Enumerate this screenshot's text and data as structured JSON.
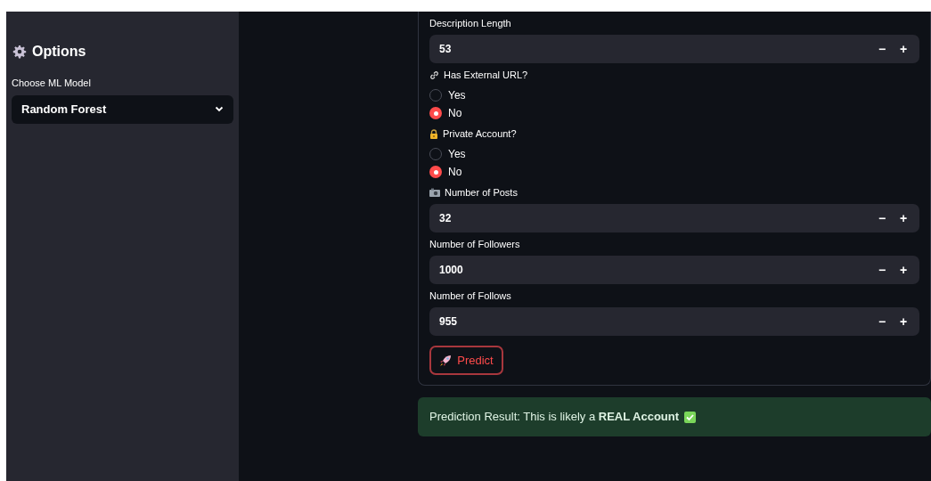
{
  "sidebar": {
    "title": "Options",
    "model_select": {
      "label": "Choose ML Model",
      "value": "Random Forest"
    }
  },
  "form": {
    "fields": [
      {
        "kind": "number",
        "label": "Description Length",
        "value": "53",
        "decrement": "−",
        "increment": "+"
      },
      {
        "kind": "radio",
        "label": "Has External URL?",
        "options": [
          {
            "label": "Yes",
            "selected": false
          },
          {
            "label": "No",
            "selected": true
          }
        ]
      },
      {
        "kind": "radio",
        "label": "Private Account?",
        "options": [
          {
            "label": "Yes",
            "selected": false
          },
          {
            "label": "No",
            "selected": true
          }
        ]
      },
      {
        "kind": "number",
        "label": "Number of Posts",
        "value": "32",
        "decrement": "−",
        "increment": "+"
      },
      {
        "kind": "number",
        "label": "Number of Followers",
        "value": "1000",
        "decrement": "−",
        "increment": "+"
      },
      {
        "kind": "number",
        "label": "Number of Follows",
        "value": "955",
        "decrement": "−",
        "increment": "+"
      }
    ],
    "submit": "Predict"
  },
  "result": {
    "text": "Prediction Result: This is likely a **REAL Account**"
  }
}
